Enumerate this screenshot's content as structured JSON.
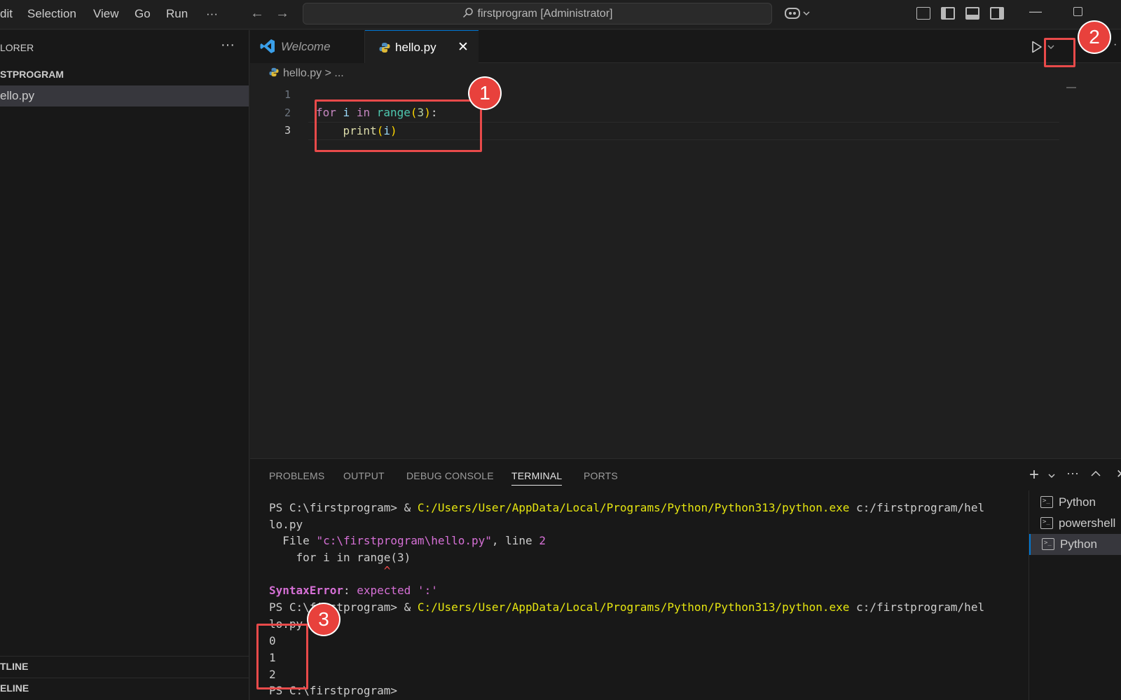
{
  "menu": [
    "dit",
    "Selection",
    "View",
    "Go",
    "Run",
    "···"
  ],
  "command_center": "firstprogram [Administrator]",
  "sidebar": {
    "title": "LORER",
    "more": "···",
    "folder": "STPROGRAM",
    "file": "ello.py",
    "outline": "TLINE",
    "timeline": "ELINE"
  },
  "tabs": {
    "welcome": "Welcome",
    "hello": "hello.py",
    "close": "✕"
  },
  "breadcrumb": "hello.py > ...",
  "gutter": [
    "1",
    "2",
    "3"
  ],
  "code": {
    "line2": {
      "kw1": "for",
      "var": "i",
      "kw2": "in",
      "fn": "range",
      "open": "(",
      "num": "3",
      "close": ")",
      "colon": ":"
    },
    "line3": {
      "indent": "    ",
      "fn": "print",
      "open": "(",
      "var": "i",
      "close": ")"
    }
  },
  "badges": [
    "1",
    "2",
    "3"
  ],
  "panel": {
    "tabs": [
      "PROBLEMS",
      "OUTPUT",
      "DEBUG CONSOLE",
      "TERMINAL",
      "PORTS"
    ]
  },
  "terminal": {
    "prompt1": "PS C:\\firstprogram> & ",
    "cmd1": "C:/Users/User/AppData/Local/Programs/Python/Python313/python.exe",
    "arg1": " c:/firstprogram/hel",
    "wrap1": "lo.py",
    "file_prefix": "  File ",
    "file_path": "\"c:\\firstprogram\\hello.py\"",
    "file_mid": ", line ",
    "file_line": "2",
    "code_echo": "    for i in range(3)",
    "caret": "                 ^",
    "err_name": "SyntaxError",
    "err_colon": ": ",
    "err_msg": "expected ':'",
    "prompt2": "PS C:\\firstprogram> & ",
    "cmd2": "C:/Users/User/AppData/Local/Programs/Python/Python313/python.exe",
    "arg2": " c:/firstprogram/hel",
    "wrap2": "lo.py",
    "out": [
      "0",
      "1",
      "2"
    ],
    "prompt3": "PS C:\\firstprogram>"
  },
  "terminal_list": [
    "Python",
    "powershell",
    "Python"
  ]
}
